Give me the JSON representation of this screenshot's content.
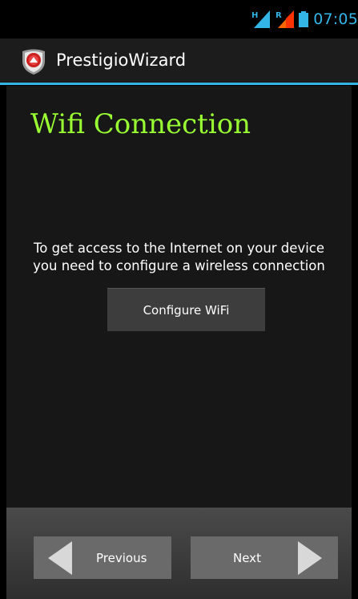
{
  "status_bar": {
    "signal_1_label": "H",
    "signal_2_label": "R",
    "time": "07:05",
    "accent_color": "#33b5e5"
  },
  "action_bar": {
    "app_title": "PrestigioWizard",
    "icon": "prestigio-shield-icon"
  },
  "main": {
    "title": "Wifi Connection",
    "description_line_1": "To get access to the Internet on your device",
    "description_line_2": "you need to configure a wireless connection",
    "configure_button_label": "Configure WiFi",
    "title_color": "#99ff33"
  },
  "footer": {
    "previous_label": "Previous",
    "next_label": "Next"
  }
}
